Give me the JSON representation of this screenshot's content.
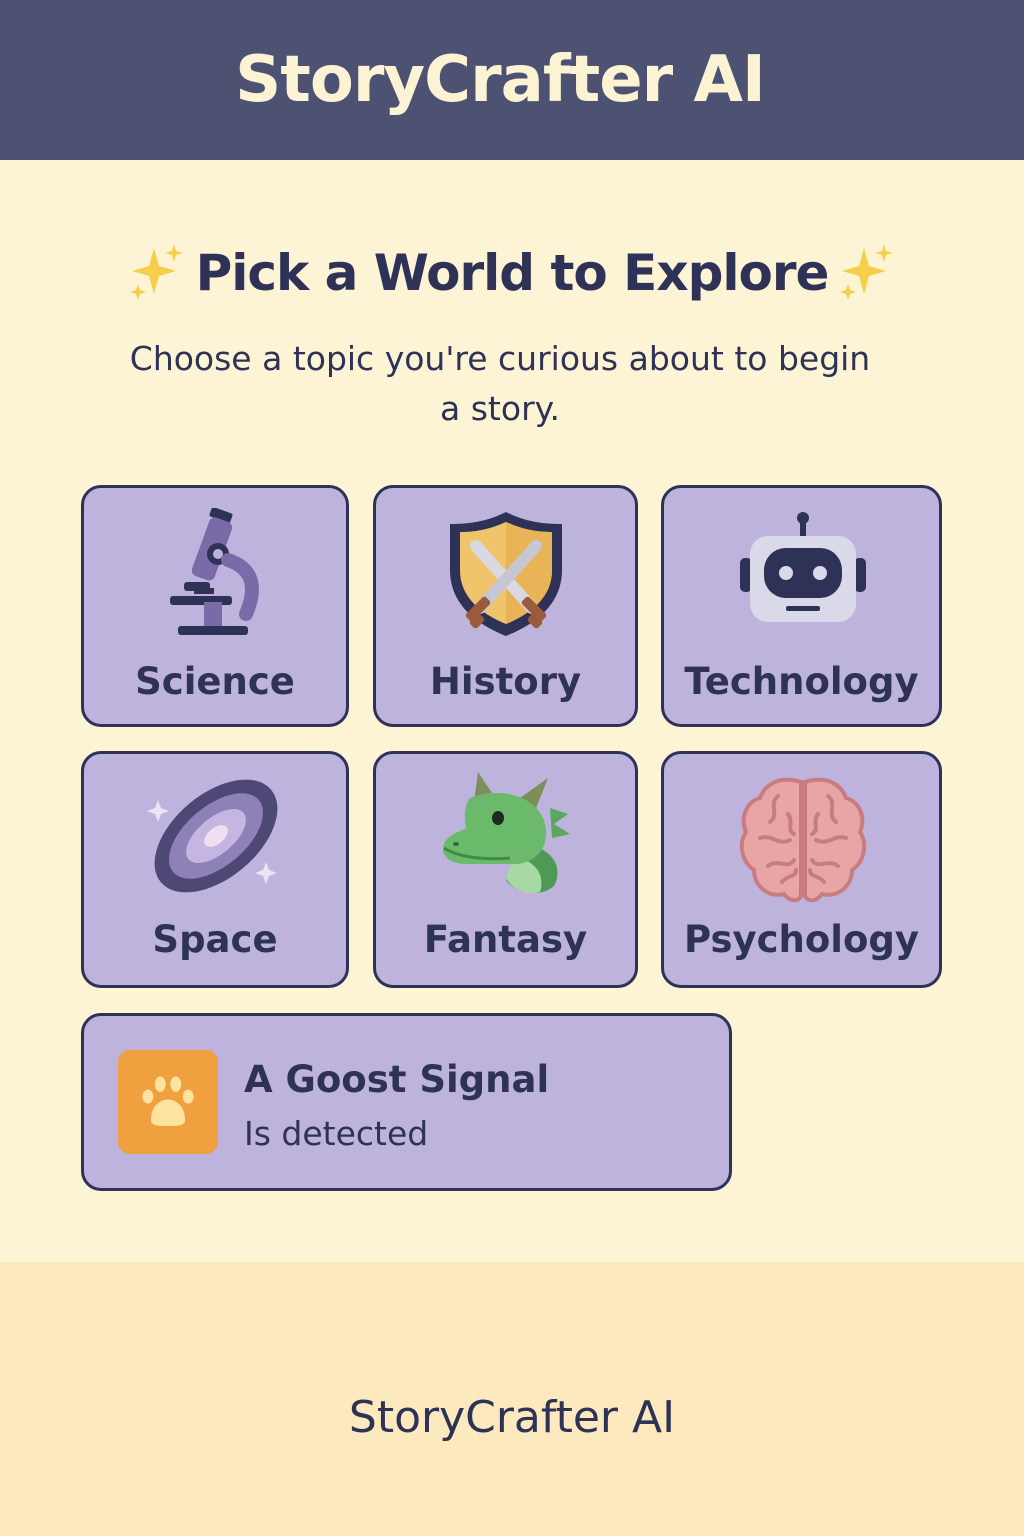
{
  "header": {
    "title": "StoryCrafter AI"
  },
  "main": {
    "heading": "Pick a World to Explore",
    "subtitle": "Choose a topic you're curious about to begin a story.",
    "topics": [
      {
        "label": "Science",
        "icon": "microscope-icon"
      },
      {
        "label": "History",
        "icon": "shield-swords-icon"
      },
      {
        "label": "Technology",
        "icon": "robot-icon"
      },
      {
        "label": "Space",
        "icon": "galaxy-icon"
      },
      {
        "label": "Fantasy",
        "icon": "dragon-icon"
      },
      {
        "label": "Psychology",
        "icon": "brain-icon"
      }
    ],
    "featured": {
      "title": "A Goost Signal",
      "subtitle": "Is detected",
      "icon": "paw-icon"
    }
  },
  "footer": {
    "brand": "StoryCrafter AI"
  },
  "colors": {
    "header_bg": "#4d5273",
    "page_bg": "#fdf4d6",
    "card_bg": "#beb3dc",
    "card_border": "#2e3256",
    "footer_bg": "#fce9bd",
    "accent_orange": "#f0a03e"
  }
}
